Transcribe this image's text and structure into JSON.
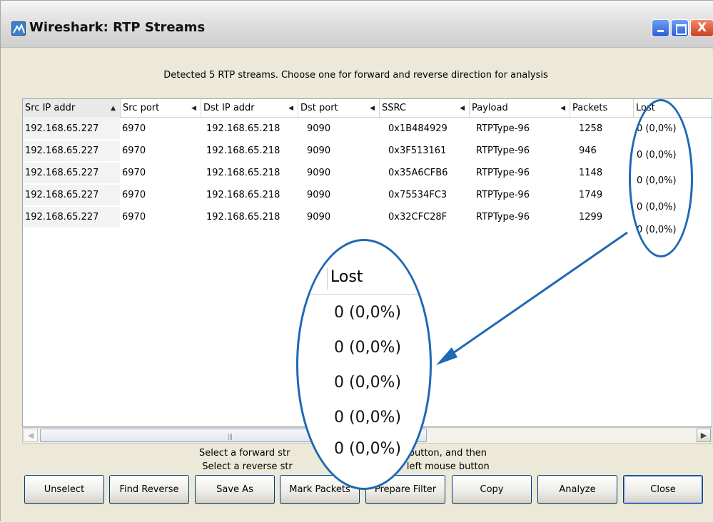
{
  "window": {
    "title": "Wireshark: RTP Streams"
  },
  "headline": "Detected 5 RTP streams. Choose one for forward and reverse direction for analysis",
  "table": {
    "columns": [
      "Src IP addr",
      "Src port",
      "Dst IP addr",
      "Dst port",
      "SSRC",
      "Payload",
      "Packets",
      "Lost"
    ],
    "rows": [
      [
        "192.168.65.227",
        "6970",
        "192.168.65.218",
        "9090",
        "0x1B484929",
        "RTPType-96",
        "1258",
        "0 (0,0%)"
      ],
      [
        "192.168.65.227",
        "6970",
        "192.168.65.218",
        "9090",
        "0x3F513161",
        "RTPType-96",
        "946",
        "0 (0,0%)"
      ],
      [
        "192.168.65.227",
        "6970",
        "192.168.65.218",
        "9090",
        "0x35A6CFB6",
        "RTPType-96",
        "1148",
        "0 (0,0%)"
      ],
      [
        "192.168.65.227",
        "6970",
        "192.168.65.218",
        "9090",
        "0x75534FC3",
        "RTPType-96",
        "1749",
        "0 (0,0%)"
      ],
      [
        "192.168.65.227",
        "6970",
        "192.168.65.218",
        "9090",
        "0x32CFC28F",
        "RTPType-96",
        "1299",
        "0 (0,0%)"
      ]
    ]
  },
  "zoom": {
    "header": "Lost",
    "values": [
      "0 (0,0%)",
      "0 (0,0%)",
      "0 (0,0%)",
      "0 (0,0%)",
      "0 (0,0%)"
    ]
  },
  "instructions": {
    "line1_left": "Select a forward str",
    "line1_right": "e button, and then",
    "line2_left": "Select a reverse str",
    "line2_right": "left mouse button"
  },
  "buttons": {
    "unselect": "Unselect",
    "find_reverse": "Find Reverse",
    "save_as": "Save As",
    "mark_packets": "Mark Packets",
    "prepare_filter": "Prepare Filter",
    "copy": "Copy",
    "analyze": "Analyze",
    "close": "Close"
  },
  "icons": {
    "minimize": "minimize-icon",
    "maximize": "maximize-icon",
    "close": "close-icon",
    "app": "wireshark-icon"
  },
  "colors": {
    "annotation": "#1f68b5",
    "close_button": "#c9401f"
  }
}
